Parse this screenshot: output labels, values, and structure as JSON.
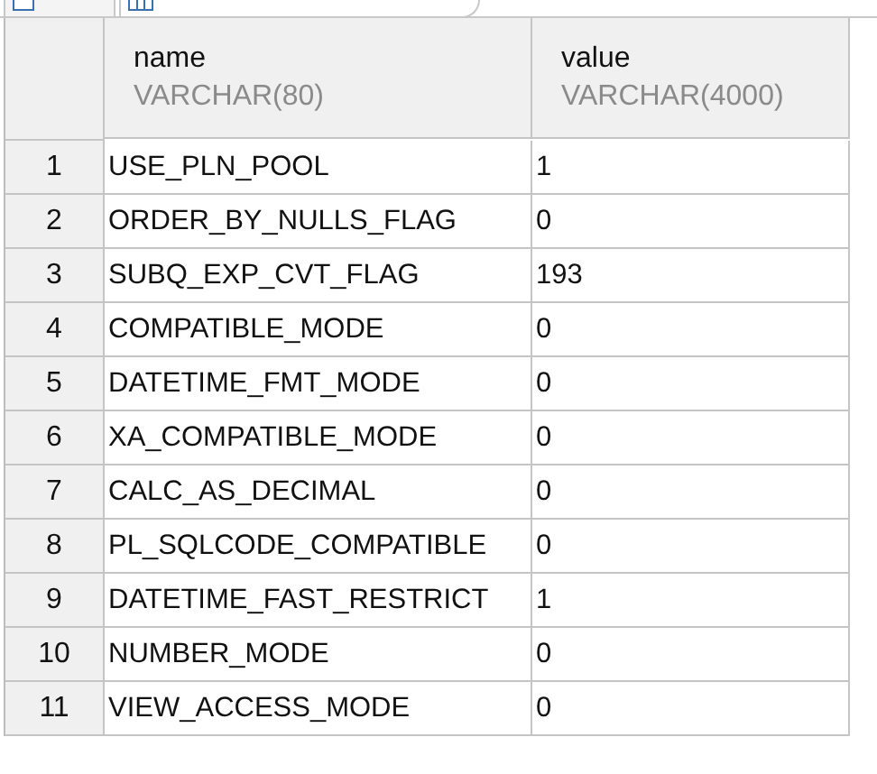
{
  "table": {
    "columns": [
      {
        "name": "name",
        "type": "VARCHAR(80)"
      },
      {
        "name": "value",
        "type": "VARCHAR(4000)"
      }
    ],
    "rows": [
      {
        "number": "1",
        "name": "USE_PLN_POOL",
        "value": "1"
      },
      {
        "number": "2",
        "name": "ORDER_BY_NULLS_FLAG",
        "value": "0"
      },
      {
        "number": "3",
        "name": "SUBQ_EXP_CVT_FLAG",
        "value": "193"
      },
      {
        "number": "4",
        "name": "COMPATIBLE_MODE",
        "value": "0"
      },
      {
        "number": "5",
        "name": "DATETIME_FMT_MODE",
        "value": "0"
      },
      {
        "number": "6",
        "name": "XA_COMPATIBLE_MODE",
        "value": "0"
      },
      {
        "number": "7",
        "name": "CALC_AS_DECIMAL",
        "value": "0"
      },
      {
        "number": "8",
        "name": "PL_SQLCODE_COMPATIBLE",
        "value": "0"
      },
      {
        "number": "9",
        "name": "DATETIME_FAST_RESTRICT",
        "value": "1"
      },
      {
        "number": "10",
        "name": "NUMBER_MODE",
        "value": "0"
      },
      {
        "number": "11",
        "name": "VIEW_ACCESS_MODE",
        "value": "0"
      }
    ]
  }
}
